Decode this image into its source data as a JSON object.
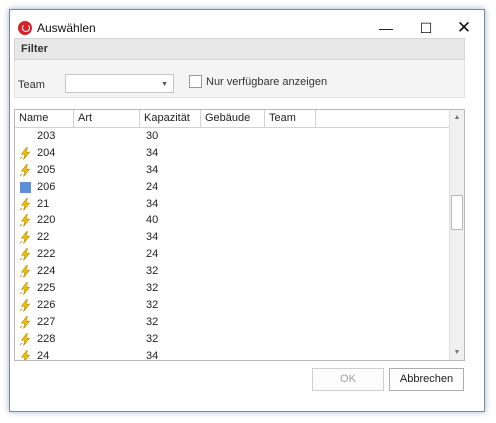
{
  "window": {
    "title": "Auswählen",
    "minimize": "—",
    "maximize": "☐",
    "close": "✕"
  },
  "filter": {
    "heading": "Filter",
    "team_label": "Team",
    "team_value": "",
    "only_available_label": "Nur verfügbare anzeigen",
    "only_available_checked": false
  },
  "table": {
    "columns": [
      "Name",
      "Art",
      "Kapazität",
      "Gebäude",
      "Team"
    ],
    "rows": [
      {
        "icon": "none",
        "name": "203",
        "art": "",
        "capacity": "30",
        "building": "",
        "team": ""
      },
      {
        "icon": "lightning-icon",
        "name": "204",
        "art": "",
        "capacity": "34",
        "building": "",
        "team": ""
      },
      {
        "icon": "lightning-icon",
        "name": "205",
        "art": "",
        "capacity": "34",
        "building": "",
        "team": ""
      },
      {
        "icon": "blue-square-icon",
        "name": "206",
        "art": "",
        "capacity": "24",
        "building": "",
        "team": ""
      },
      {
        "icon": "lightning-icon",
        "name": "21",
        "art": "",
        "capacity": "34",
        "building": "",
        "team": ""
      },
      {
        "icon": "lightning-icon",
        "name": "220",
        "art": "",
        "capacity": "40",
        "building": "",
        "team": ""
      },
      {
        "icon": "lightning-icon",
        "name": "22",
        "art": "",
        "capacity": "34",
        "building": "",
        "team": ""
      },
      {
        "icon": "lightning-icon",
        "name": "222",
        "art": "",
        "capacity": "24",
        "building": "",
        "team": ""
      },
      {
        "icon": "lightning-icon",
        "name": "224",
        "art": "",
        "capacity": "32",
        "building": "",
        "team": ""
      },
      {
        "icon": "lightning-icon",
        "name": "225",
        "art": "",
        "capacity": "32",
        "building": "",
        "team": ""
      },
      {
        "icon": "lightning-icon",
        "name": "226",
        "art": "",
        "capacity": "32",
        "building": "",
        "team": ""
      },
      {
        "icon": "lightning-icon",
        "name": "227",
        "art": "",
        "capacity": "32",
        "building": "",
        "team": ""
      },
      {
        "icon": "lightning-icon",
        "name": "228",
        "art": "",
        "capacity": "32",
        "building": "",
        "team": ""
      },
      {
        "icon": "lightning-icon",
        "name": "24",
        "art": "",
        "capacity": "34",
        "building": "",
        "team": ""
      }
    ]
  },
  "buttons": {
    "ok": "OK",
    "cancel": "Abbrechen"
  },
  "colors": {
    "accent_red": "#d6232a",
    "lightning": "#f2c200",
    "room_blue": "#5b8fd9"
  }
}
